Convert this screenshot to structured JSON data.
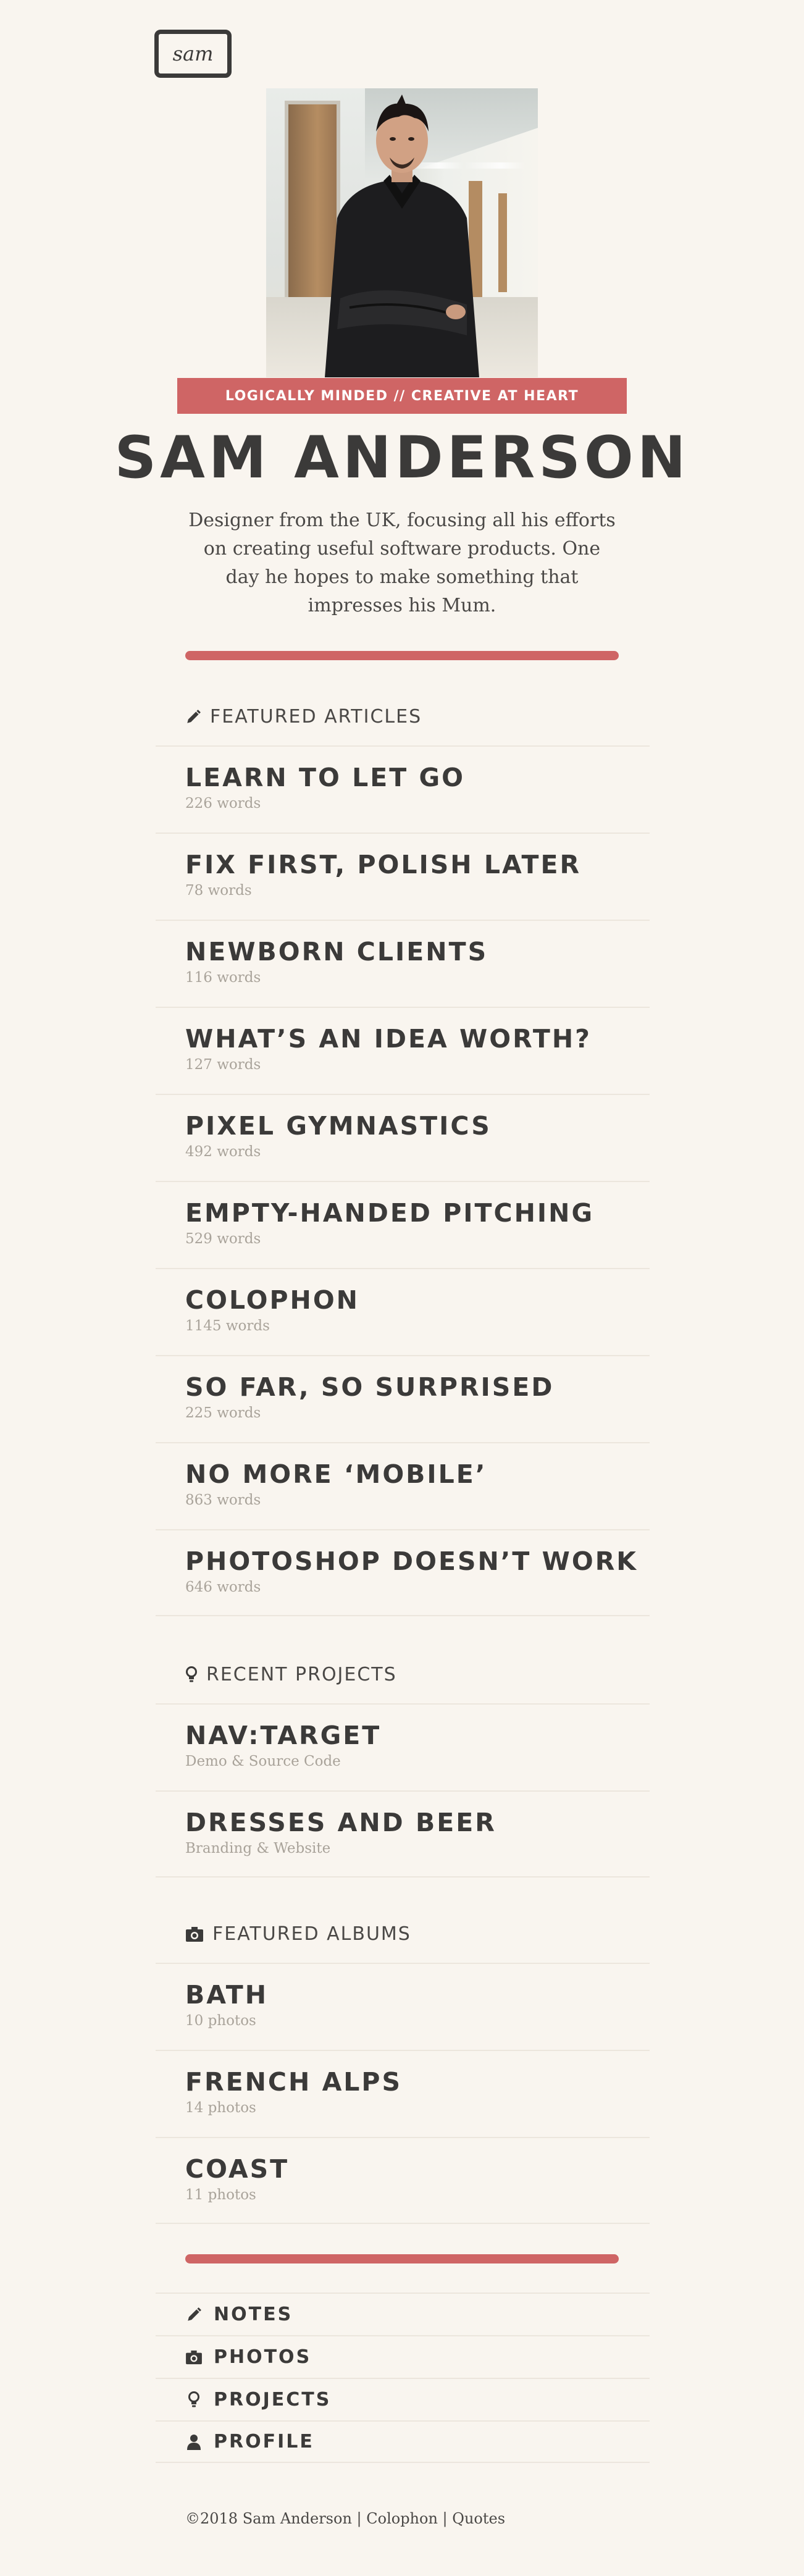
{
  "logo": {
    "text": "sam"
  },
  "hero": {
    "tagline": "LOGICALLY MINDED // CREATIVE AT HEART",
    "name": "SAM ANDERSON",
    "bio": "Designer from the UK, focusing all his efforts on creating useful software products. One day he hopes to make something that impresses his Mum."
  },
  "articles": {
    "title": "FEATURED ARTICLES",
    "icon": "pencil-icon",
    "items": [
      {
        "title": "LEARN TO LET GO",
        "meta": "226 words"
      },
      {
        "title": "FIX FIRST, POLISH LATER",
        "meta": "78 words"
      },
      {
        "title": "NEWBORN CLIENTS",
        "meta": "116 words"
      },
      {
        "title": "WHAT’S AN IDEA WORTH?",
        "meta": "127 words"
      },
      {
        "title": "PIXEL GYMNASTICS",
        "meta": "492 words"
      },
      {
        "title": "EMPTY-HANDED PITCHING",
        "meta": "529 words"
      },
      {
        "title": "COLOPHON",
        "meta": "1145 words"
      },
      {
        "title": "SO FAR, SO SURPRISED",
        "meta": "225 words"
      },
      {
        "title": "NO MORE ‘MOBILE’",
        "meta": "863 words"
      },
      {
        "title": "PHOTOSHOP DOESN’T WORK",
        "meta": "646 words"
      }
    ]
  },
  "projects": {
    "title": "RECENT PROJECTS",
    "icon": "lightbulb-icon",
    "items": [
      {
        "title": "NAV:TARGET",
        "meta": "Demo & Source Code"
      },
      {
        "title": "DRESSES AND BEER",
        "meta": "Branding & Website"
      }
    ]
  },
  "albums": {
    "title": "FEATURED ALBUMS",
    "icon": "camera-icon",
    "items": [
      {
        "title": "BATH",
        "meta": "10 photos"
      },
      {
        "title": "FRENCH ALPS",
        "meta": "14 photos"
      },
      {
        "title": "COAST",
        "meta": "11 photos"
      }
    ]
  },
  "nav": [
    {
      "label": "NOTES",
      "icon": "pencil-icon"
    },
    {
      "label": "PHOTOS",
      "icon": "camera-icon"
    },
    {
      "label": "PROJECTS",
      "icon": "lightbulb-icon"
    },
    {
      "label": "PROFILE",
      "icon": "user-icon"
    }
  ],
  "footer": {
    "copyright": "©2018 Sam Anderson",
    "sep": " | ",
    "colophon": "Colophon",
    "quotes": "Quotes"
  },
  "colors": {
    "accent": "#cf6565",
    "text": "#3b3a39",
    "background": "#f9f5ef",
    "muted": "#a9a39a"
  }
}
